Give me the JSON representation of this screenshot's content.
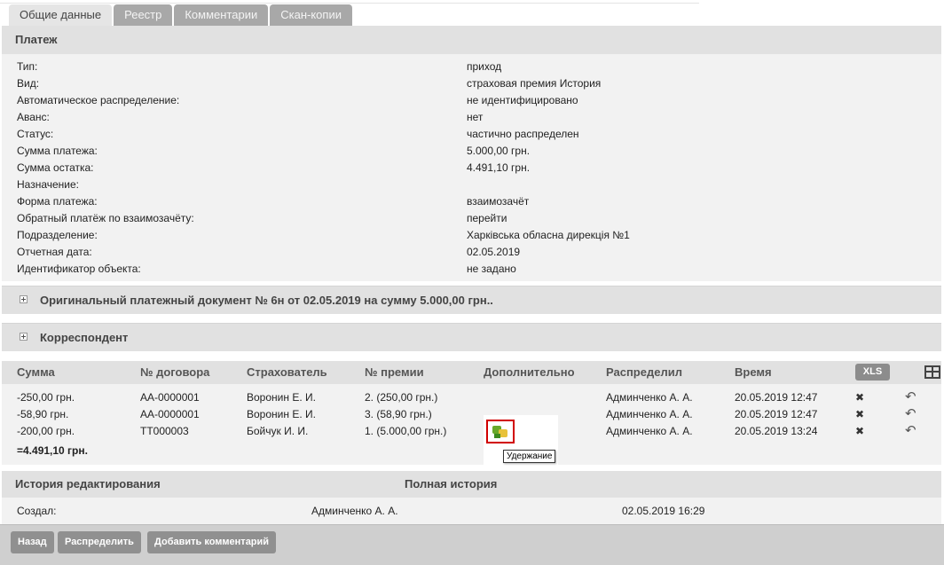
{
  "tabs": [
    {
      "label": "Общие данные",
      "active": true
    },
    {
      "label": "Реестр",
      "active": false
    },
    {
      "label": "Комментарии",
      "active": false
    },
    {
      "label": "Скан-копии",
      "active": false
    }
  ],
  "payment": {
    "title": "Платеж",
    "fields": [
      {
        "key": "Тип:",
        "value": "приход"
      },
      {
        "key": "Вид:",
        "value": "страховая премия История"
      },
      {
        "key": "Автоматическое распределение:",
        "value": "не идентифицировано"
      },
      {
        "key": "Аванс:",
        "value": "нет"
      },
      {
        "key": "Статус:",
        "value": "частично распределен"
      },
      {
        "key": "Сумма платежа:",
        "value": "5.000,00 грн."
      },
      {
        "key": "Сумма остатка:",
        "value": "4.491,10 грн."
      },
      {
        "key": "Назначение:",
        "value": ""
      },
      {
        "key": "Форма платежа:",
        "value": "взаимозачёт"
      },
      {
        "key": "Обратный платёж по взаимозачёту:",
        "value": "перейти"
      },
      {
        "key": "Подразделение:",
        "value": "Харківська обласна дирекція №1"
      },
      {
        "key": "Отчетная дата:",
        "value": "02.05.2019"
      },
      {
        "key": "Идентификатор объекта:",
        "value": "не задано"
      }
    ]
  },
  "original_doc": {
    "title": "Оригинальный платежный документ № 6н от 02.05.2019 на сумму 5.000,00 грн.."
  },
  "correspondent": {
    "title": "Корреспондент"
  },
  "table": {
    "headers": [
      "Сумма",
      "№ договора",
      "Страхователь",
      "№ премии",
      "Дополнительно",
      "Распределил",
      "Время"
    ],
    "xls_label": "XLS",
    "rows": [
      {
        "sum": "-250,00 грн.",
        "contract": "АА-0000001",
        "insurer": "Воронин Е. И.",
        "premium": "2. (250,00 грн.)",
        "by": "Админченко А. А.",
        "time": "20.05.2019 12:47"
      },
      {
        "sum": "-58,90 грн.",
        "contract": "АА-0000001",
        "insurer": "Воронин Е. И.",
        "premium": "3. (58,90 грн.)",
        "by": "Админченко А. А.",
        "time": "20.05.2019 12:47"
      },
      {
        "sum": "-200,00 грн.",
        "contract": "ТТ000003",
        "insurer": "Бойчук И. И.",
        "premium": "1. (5.000,00 грн.)",
        "by": "Админченко А. А.",
        "time": "20.05.2019 13:24"
      }
    ],
    "total": "=4.491,10 грн.",
    "tooltip": "Удержание",
    "icons": {
      "delete": "delete-icon",
      "undo": "undo-icon",
      "hold": "hold-icon",
      "columns": "columns-grid-icon"
    }
  },
  "history": {
    "title": "История редактирования",
    "full_link": "Полная история",
    "created_label": "Создал:",
    "created_by": "Админченко А. А.",
    "created_at": "02.05.2019 16:29"
  },
  "buttons": {
    "back": "Назад",
    "distribute": "Распределить",
    "add_comment": "Добавить комментарий"
  }
}
